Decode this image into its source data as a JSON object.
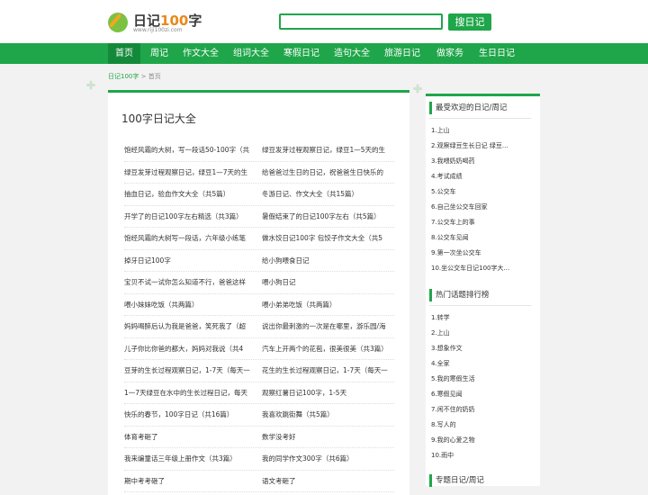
{
  "header": {
    "logo_main": "日记",
    "logo_num": "100",
    "logo_tail": "字",
    "logo_sub": "www.riji100zi.com",
    "search_placeholder": "",
    "search_button": "搜日记"
  },
  "nav": [
    "首页",
    "周记",
    "作文大全",
    "组词大全",
    "寒假日记",
    "造句大全",
    "旅游日记",
    "做家务",
    "生日日记"
  ],
  "breadcrumb": {
    "home": "日记100字",
    "sep": " > ",
    "current": "首页"
  },
  "main": {
    "title": "100字日记大全",
    "rows": [
      [
        "饱经风霜的大树，写一段话50-100字（共",
        "绿豆发芽过程观察日记，绿豆1—5天的生"
      ],
      [
        "绿豆发芽过程观察日记，绿豆1—7天的生",
        "给爸爸过生日的日记，祝爸爸生日快乐的"
      ],
      [
        "抽血日记，验血作文大全（共5篇）",
        "冬游日记、作文大全（共15篇）"
      ],
      [
        "开学了的日记100字左右精选（共3篇）",
        "暑假结束了的日记100字左右（共5篇）"
      ],
      [
        "饱经风霜的大树写一段话，六年级小练笔",
        "做水饺日记100字 包饺子作文大全（共5"
      ],
      [
        "掉牙日记100字",
        "给小狗喂食日记"
      ],
      [
        "宝贝不试一试你怎么知道不行，爸爸这样",
        "喂小狗日记"
      ],
      [
        "喂小妹妹吃饭（共两篇）",
        "喂小弟弟吃饭（共两篇）"
      ],
      [
        "妈妈喝醉后认为我是爸爸，笑死我了（超",
        "说出你最刺激的一次是在哪里，游乐园/海"
      ],
      [
        "儿子你比你爸的都大，妈妈对我说（共4",
        "汽车上开两个的花苞，很美很美（共3篇）"
      ],
      [
        "豆芽的生长过程观察日记，1-7天（每天一",
        "花生的生长过程观察日记，1-7天（每天一"
      ],
      [
        "1一7天绿豆在水中的生长过程日记，每天",
        "观察红薯日记100字，1-5天"
      ],
      [
        "快乐的春节，100字日记（共16篇）",
        "我喜欢跳街舞（共5篇）"
      ],
      [
        "体育考砸了",
        "数学没考好"
      ],
      [
        "我来编童话三年级上册作文（共3篇）",
        "我的同学作文300字（共6篇）"
      ],
      [
        "期中考考砸了",
        "语文考砸了"
      ]
    ]
  },
  "sidebar": {
    "popular_title": "最受欢迎的日记/周记",
    "popular": [
      "1.上山",
      "2.观察绿豆生长日记 绿豆...",
      "3.我喂奶奶喝药",
      "4.考试成绩",
      "5.公交车",
      "6.自己坐公交车回家",
      "7.公交车上的事",
      "8.公交车见闻",
      "9.第一次坐公交车",
      "10.坐公交车日记100字大..."
    ],
    "hot_title": "热门话题排行榜",
    "hot": [
      "1.转学",
      "2.上山",
      "3.想象作文",
      "4.全家",
      "5.我的寒假生活",
      "6.寒假见闻",
      "7.闲不住的奶奶",
      "8.写人的",
      "9.我的心爱之物",
      "10.雨中"
    ],
    "topic_title": "专题日记/周记"
  }
}
